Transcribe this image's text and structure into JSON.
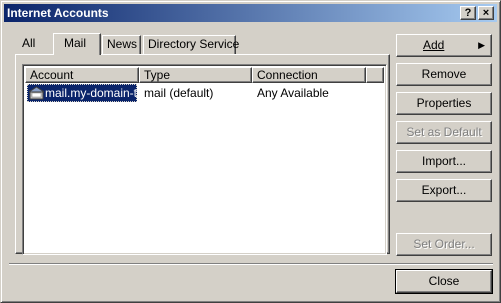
{
  "window": {
    "title": "Internet Accounts"
  },
  "title_buttons": {
    "help": "?",
    "close": "×"
  },
  "tabs": [
    {
      "label": "All",
      "active": false
    },
    {
      "label": "Mail",
      "active": true
    },
    {
      "label": "News",
      "active": false
    },
    {
      "label": "Directory Service",
      "active": false
    }
  ],
  "list": {
    "columns": [
      "Account",
      "Type",
      "Connection"
    ],
    "rows": [
      {
        "account": "mail.my-domain-t...",
        "type": "mail (default)",
        "connection": "Any Available",
        "selected": true
      }
    ]
  },
  "buttons": {
    "add": "Add",
    "add_arrow": "▶",
    "remove": "Remove",
    "properties": "Properties",
    "set_default": "Set as Default",
    "import": "Import...",
    "export": "Export...",
    "set_order": "Set Order...",
    "close": "Close"
  },
  "colors": {
    "titlebar_start": "#0a246a",
    "titlebar_end": "#a6caf0",
    "selection": "#0a246a",
    "face": "#d4d0c8"
  }
}
